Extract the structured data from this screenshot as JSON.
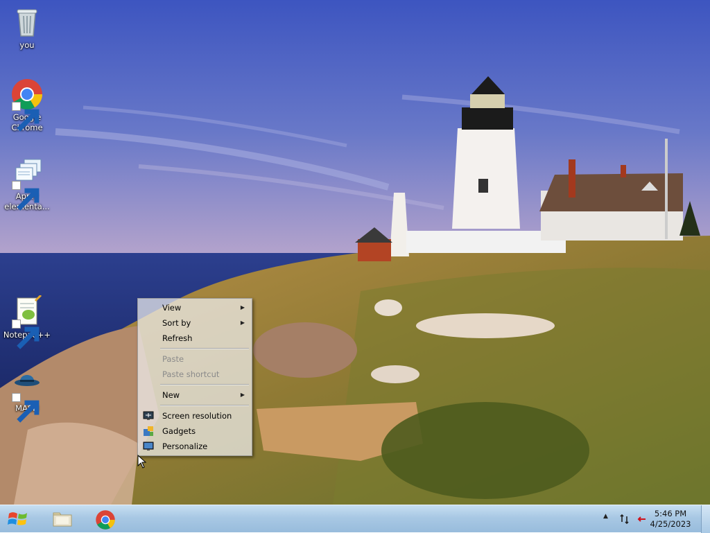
{
  "desktop": {
    "icons": [
      {
        "label": "you",
        "icon": "recycle-bin-icon"
      },
      {
        "label": "Google Chrome",
        "icon": "chrome-icon"
      },
      {
        "label": "Apply elementa...",
        "icon": "windows-files-icon"
      },
      {
        "label": "Notepad++",
        "icon": "notepad-plus-plus-icon"
      },
      {
        "label": "MASH",
        "icon": "mash-icon"
      }
    ]
  },
  "context_menu": {
    "items": [
      {
        "label": "View",
        "submenu": true,
        "disabled": false
      },
      {
        "label": "Sort by",
        "submenu": true,
        "disabled": false
      },
      {
        "label": "Refresh",
        "submenu": false,
        "disabled": false
      },
      {
        "label": "Paste",
        "submenu": false,
        "disabled": true
      },
      {
        "label": "Paste shortcut",
        "submenu": false,
        "disabled": true
      },
      {
        "label": "New",
        "submenu": true,
        "disabled": false
      },
      {
        "label": "Screen resolution",
        "icon": "screen-resolution-icon"
      },
      {
        "label": "Gadgets",
        "icon": "gadgets-icon"
      },
      {
        "label": "Personalize",
        "icon": "personalize-icon"
      }
    ],
    "submenu_arrow": "▶"
  },
  "taskbar": {
    "pinned": [
      {
        "name": "start",
        "icon": "windows-logo-icon"
      },
      {
        "name": "windows-explorer",
        "icon": "folder-icon"
      },
      {
        "name": "google-chrome",
        "icon": "chrome-icon"
      }
    ],
    "tray": {
      "show_hidden_label": "▲",
      "time": "5:46 PM",
      "date": "4/25/2023"
    }
  },
  "colors": {
    "taskbar_top": "#c7dff2",
    "taskbar_bottom": "#98bcdc",
    "menu_background": "#f0f0f0",
    "disabled_text": "#8a8a8a"
  }
}
